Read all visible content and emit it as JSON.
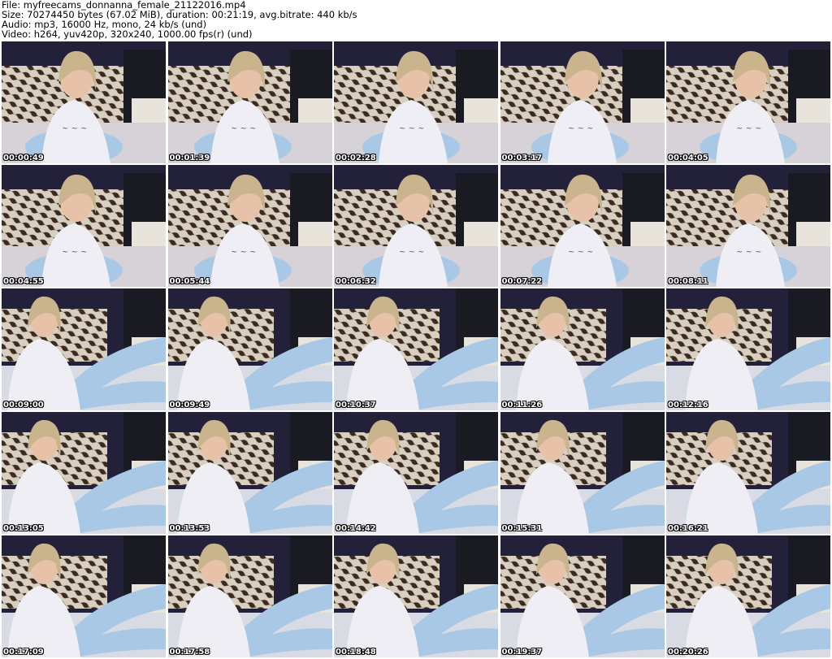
{
  "header": {
    "file_line": "File: myfreecams_donnanna_female_21122016.mp4",
    "size_line": "Size: 70274450 bytes (67.02 MiB), duration: 00:21:19, avg.bitrate: 440 kb/s",
    "audio_line": "Audio: mp3, 16000 Hz, mono, 24 kb/s (und)",
    "video_line": "Video: h264, yuv420p, 320x240, 1000.00 fps(r) (und)"
  },
  "thumbnails": [
    {
      "timestamp": "00:00:49",
      "scene": "a"
    },
    {
      "timestamp": "00:01:39",
      "scene": "a"
    },
    {
      "timestamp": "00:02:28",
      "scene": "a"
    },
    {
      "timestamp": "00:03:17",
      "scene": "a"
    },
    {
      "timestamp": "00:04:05",
      "scene": "a"
    },
    {
      "timestamp": "00:04:55",
      "scene": "a"
    },
    {
      "timestamp": "00:05:44",
      "scene": "a"
    },
    {
      "timestamp": "00:06:32",
      "scene": "a"
    },
    {
      "timestamp": "00:07:22",
      "scene": "a"
    },
    {
      "timestamp": "00:08:11",
      "scene": "a"
    },
    {
      "timestamp": "00:09:00",
      "scene": "b"
    },
    {
      "timestamp": "00:09:49",
      "scene": "b"
    },
    {
      "timestamp": "00:10:37",
      "scene": "b"
    },
    {
      "timestamp": "00:11:26",
      "scene": "b"
    },
    {
      "timestamp": "00:12:16",
      "scene": "b"
    },
    {
      "timestamp": "00:13:05",
      "scene": "b"
    },
    {
      "timestamp": "00:13:53",
      "scene": "b"
    },
    {
      "timestamp": "00:14:42",
      "scene": "b"
    },
    {
      "timestamp": "00:15:31",
      "scene": "b"
    },
    {
      "timestamp": "00:16:21",
      "scene": "b"
    },
    {
      "timestamp": "00:17:09",
      "scene": "b"
    },
    {
      "timestamp": "00:17:58",
      "scene": "b"
    },
    {
      "timestamp": "00:18:48",
      "scene": "b"
    },
    {
      "timestamp": "00:19:37",
      "scene": "b"
    },
    {
      "timestamp": "00:20:26",
      "scene": "b"
    }
  ],
  "colors": {
    "wall": "#23203a",
    "zebra_light": "#d8cfc0",
    "zebra_dark": "#3a2a22",
    "shirt": "#eeeef4",
    "jeans": "#a8c8e6",
    "hair": "#c9b48e",
    "skin": "#e8c2a8",
    "stamp_text": "#ffffff"
  }
}
